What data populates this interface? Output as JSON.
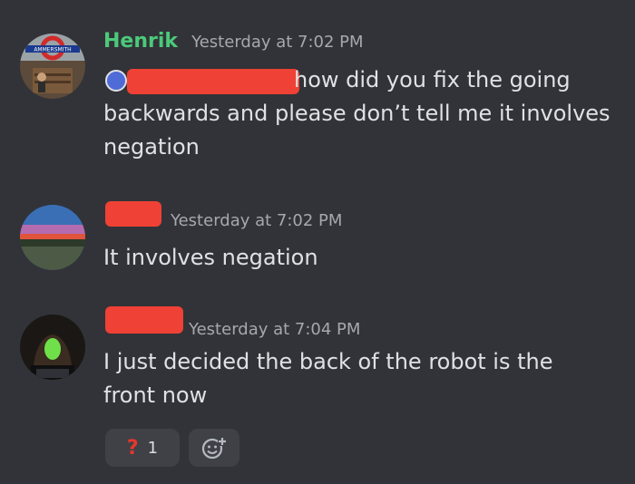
{
  "messages": [
    {
      "author": "Henrik",
      "timestamp": "Yesterday at 7:02 PM",
      "avatar_icon": "hammersmith-sign-avatar",
      "avatar_sign_text": "AMMERSMITH",
      "reply_icon": "reply-avatar-icon",
      "lines": [
        "how did you fix the going",
        "backwards and please don’t tell me it involves",
        "negation"
      ]
    },
    {
      "author": "",
      "timestamp": "Yesterday at 7:02 PM",
      "avatar_icon": "sunset-landscape-avatar",
      "lines": [
        "It involves negation"
      ]
    },
    {
      "author": "",
      "timestamp": "Yesterday at 7:04 PM",
      "avatar_icon": "hooded-figure-avatar",
      "lines": [
        "I just decided the back of the robot is the",
        "front now"
      ],
      "reactions": [
        {
          "emoji": "?",
          "count": "1",
          "icon": "red-question-mark-icon"
        }
      ],
      "add_reaction_icon": "add-reaction-icon"
    }
  ],
  "colors": {
    "background": "#313338",
    "username": "#4cc97a",
    "timestamp": "#a5a8ad",
    "text": "#dfe1e5",
    "redaction": "#ef4135",
    "reaction_bg": "#3f4147"
  }
}
